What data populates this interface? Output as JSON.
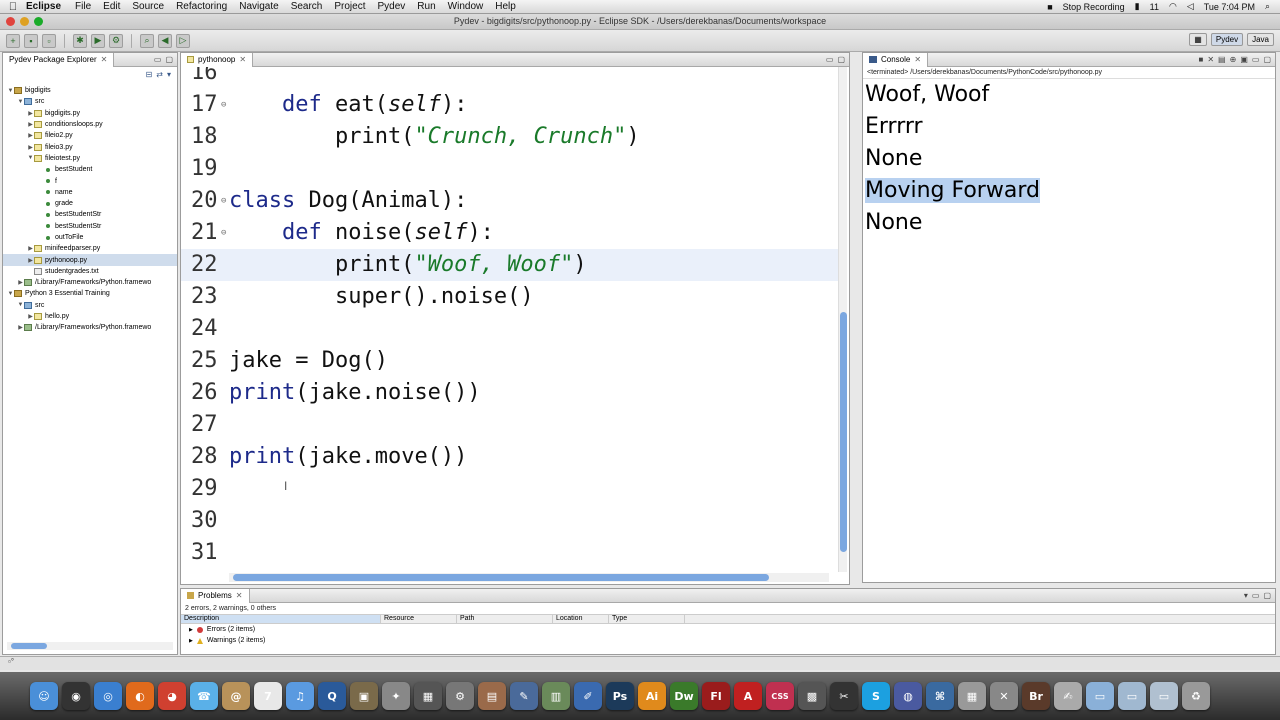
{
  "menubar": {
    "app": "Eclipse",
    "items": [
      "File",
      "Edit",
      "Source",
      "Refactoring",
      "Navigate",
      "Search",
      "Project",
      "Pydev",
      "Run",
      "Window",
      "Help"
    ],
    "stop_recording": "Stop Recording",
    "battery": "11",
    "clock": "Tue 7:04 PM"
  },
  "window": {
    "title": "Pydev - bigdigits/src/pythonoop.py - Eclipse SDK - /Users/derekbanas/Documents/workspace"
  },
  "perspectives": {
    "pydev": "Pydev",
    "java": "Java"
  },
  "explorer": {
    "tab_label": "Pydev Package Explorer",
    "tree": [
      {
        "label": "bigdigits",
        "icon": "project-icon",
        "indent": 0,
        "twisty": "▼"
      },
      {
        "label": "src",
        "icon": "package-icon",
        "indent": 1,
        "twisty": "▼"
      },
      {
        "label": "bigdigits.py",
        "icon": "python-file-icon",
        "indent": 2,
        "twisty": "▶"
      },
      {
        "label": "conditionsloops.py",
        "icon": "python-file-icon",
        "indent": 2,
        "twisty": "▶"
      },
      {
        "label": "fileio2.py",
        "icon": "python-file-icon",
        "indent": 2,
        "twisty": "▶"
      },
      {
        "label": "fileio3.py",
        "icon": "python-file-icon",
        "indent": 2,
        "twisty": "▶"
      },
      {
        "label": "fileiotest.py",
        "icon": "python-file-icon",
        "indent": 2,
        "twisty": "▼"
      },
      {
        "label": "bestStudent",
        "icon": "variable-icon",
        "indent": 3,
        "twisty": ""
      },
      {
        "label": "f",
        "icon": "variable-icon",
        "indent": 3,
        "twisty": ""
      },
      {
        "label": "name",
        "icon": "variable-icon",
        "indent": 3,
        "twisty": ""
      },
      {
        "label": "grade",
        "icon": "variable-icon",
        "indent": 3,
        "twisty": ""
      },
      {
        "label": "bestStudentStr",
        "icon": "variable-icon",
        "indent": 3,
        "twisty": ""
      },
      {
        "label": "bestStudentStr",
        "icon": "variable-icon",
        "indent": 3,
        "twisty": ""
      },
      {
        "label": "outToFile",
        "icon": "variable-icon",
        "indent": 3,
        "twisty": ""
      },
      {
        "label": "minifeedparser.py",
        "icon": "python-file-icon",
        "indent": 2,
        "twisty": "▶"
      },
      {
        "label": "pythonoop.py",
        "icon": "python-file-icon",
        "indent": 2,
        "twisty": "▶",
        "selected": true
      },
      {
        "label": "studentgrades.txt",
        "icon": "text-file-icon",
        "indent": 2,
        "twisty": ""
      },
      {
        "label": "/Library/Frameworks/Python.framewo",
        "icon": "library-icon",
        "indent": 1,
        "twisty": "▶"
      },
      {
        "label": "Python 3 Essential Training",
        "icon": "project-icon",
        "indent": 0,
        "twisty": "▼"
      },
      {
        "label": "src",
        "icon": "package-icon",
        "indent": 1,
        "twisty": "▼"
      },
      {
        "label": "hello.py",
        "icon": "python-file-icon",
        "indent": 2,
        "twisty": "▶"
      },
      {
        "label": "/Library/Frameworks/Python.framewo",
        "icon": "library-icon",
        "indent": 1,
        "twisty": "▶"
      }
    ]
  },
  "editor": {
    "tab_label": "pythonoop",
    "lines": [
      {
        "num": "16",
        "tokens": []
      },
      {
        "num": "17",
        "fold": true,
        "tokens": [
          [
            "",
            "    "
          ],
          [
            "kw",
            "def"
          ],
          [
            "",
            " eat("
          ],
          [
            "slf",
            "self"
          ],
          [
            "",
            "):"
          ]
        ]
      },
      {
        "num": "18",
        "tokens": [
          [
            "",
            "        print("
          ],
          [
            "str",
            "\"Crunch, Crunch\""
          ],
          [
            "",
            ")"
          ]
        ]
      },
      {
        "num": "19",
        "tokens": []
      },
      {
        "num": "20",
        "fold": true,
        "tokens": [
          [
            "kw",
            "class"
          ],
          [
            "",
            " Dog(Animal):"
          ]
        ]
      },
      {
        "num": "21",
        "fold": true,
        "tokens": [
          [
            "",
            "    "
          ],
          [
            "kw",
            "def"
          ],
          [
            "",
            " noise("
          ],
          [
            "slf",
            "self"
          ],
          [
            "",
            "):"
          ]
        ]
      },
      {
        "num": "22",
        "highlight": true,
        "tokens": [
          [
            "",
            "        print("
          ],
          [
            "str",
            "\"Woof, Woof\""
          ],
          [
            "",
            ")"
          ]
        ]
      },
      {
        "num": "23",
        "tokens": [
          [
            "",
            "        super().noise()"
          ]
        ]
      },
      {
        "num": "24",
        "tokens": []
      },
      {
        "num": "25",
        "tokens": [
          [
            "",
            "jake = Dog()"
          ]
        ]
      },
      {
        "num": "26",
        "tokens": [
          [
            "kw",
            "print"
          ],
          [
            "",
            "(jake.noise())"
          ]
        ]
      },
      {
        "num": "27",
        "tokens": []
      },
      {
        "num": "28",
        "tokens": [
          [
            "kw",
            "print"
          ],
          [
            "",
            "(jake.move())"
          ]
        ]
      },
      {
        "num": "29",
        "tokens": []
      },
      {
        "num": "30",
        "tokens": []
      },
      {
        "num": "31",
        "tokens": []
      }
    ]
  },
  "console": {
    "tab_label": "Console",
    "header": "<terminated> /Users/derekbanas/Documents/PythonCode/src/pythonoop.py",
    "output": [
      "Woof, Woof",
      "Errrrr",
      "None",
      "Moving Forward",
      "None"
    ],
    "selected_line_index": 3
  },
  "problems": {
    "tab_label": "Problems",
    "summary": "2 errors, 2 warnings, 0 others",
    "columns": [
      "Description",
      "Resource",
      "Path",
      "Location",
      "Type"
    ],
    "rows": [
      {
        "label": "Errors (2 items)",
        "kind": "error"
      },
      {
        "label": "Warnings (2 items)",
        "kind": "warning"
      }
    ]
  },
  "dock": {
    "apps": [
      {
        "name": "finder",
        "glyph": "☺",
        "color": "#4a8fd8"
      },
      {
        "name": "dashboard",
        "glyph": "◉",
        "color": "#333"
      },
      {
        "name": "safari",
        "glyph": "◎",
        "color": "#3a7fd0"
      },
      {
        "name": "firefox",
        "glyph": "◐",
        "color": "#e06a1c"
      },
      {
        "name": "chrome",
        "glyph": "◕",
        "color": "#d04030"
      },
      {
        "name": "ichat",
        "glyph": "☎",
        "color": "#5ab0e8"
      },
      {
        "name": "address-book",
        "glyph": "@",
        "color": "#b8925a"
      },
      {
        "name": "ical",
        "glyph": "7",
        "color": "#e8e8e8"
      },
      {
        "name": "itunes",
        "glyph": "♫",
        "color": "#5a9ae0"
      },
      {
        "name": "quicktime",
        "glyph": "Q",
        "color": "#2a5a9a"
      },
      {
        "name": "preview",
        "glyph": "▣",
        "color": "#7a6a4a"
      },
      {
        "name": "automator",
        "glyph": "✦",
        "color": "#888"
      },
      {
        "name": "mission-control",
        "glyph": "▦",
        "color": "#555"
      },
      {
        "name": "system-preferences",
        "glyph": "⚙",
        "color": "#777"
      },
      {
        "name": "photo",
        "glyph": "▤",
        "color": "#9a6a4a"
      },
      {
        "name": "xcode",
        "glyph": "✎",
        "color": "#4a6a9a"
      },
      {
        "name": "calculator",
        "glyph": "▥",
        "color": "#6a8a5a"
      },
      {
        "name": "text-edit",
        "glyph": "✐",
        "color": "#3a6ab0"
      },
      {
        "name": "photoshop",
        "glyph": "Ps",
        "color": "#1c3a5a"
      },
      {
        "name": "illustrator",
        "glyph": "Ai",
        "color": "#e08a1c"
      },
      {
        "name": "dreamweaver",
        "glyph": "Dw",
        "color": "#3a7a2a"
      },
      {
        "name": "flash",
        "glyph": "Fl",
        "color": "#9a1c1c"
      },
      {
        "name": "acrobat",
        "glyph": "A",
        "color": "#c02020"
      },
      {
        "name": "css-edit",
        "glyph": "CSS",
        "color": "#c03050"
      },
      {
        "name": "media-app",
        "glyph": "▩",
        "color": "#555"
      },
      {
        "name": "final-cut",
        "glyph": "✂",
        "color": "#333"
      },
      {
        "name": "skype",
        "glyph": "S",
        "color": "#1ca0e0"
      },
      {
        "name": "network",
        "glyph": "◍",
        "color": "#4a5aa0"
      },
      {
        "name": "python-launcher",
        "glyph": "⌘",
        "color": "#3a6aa0"
      },
      {
        "name": "terminal",
        "glyph": "▦",
        "color": "#999"
      },
      {
        "name": "utility",
        "glyph": "✕",
        "color": "#888"
      },
      {
        "name": "bridge",
        "glyph": "Br",
        "color": "#5a3a2a"
      },
      {
        "name": "script-editor",
        "glyph": "✍",
        "color": "#aaa"
      },
      {
        "name": "folder",
        "glyph": "▭",
        "color": "#8ab0d8"
      },
      {
        "name": "documents",
        "glyph": "▭",
        "color": "#a0b8d0"
      },
      {
        "name": "downloads",
        "glyph": "▭",
        "color": "#b0c0d0"
      },
      {
        "name": "trash",
        "glyph": "♻",
        "color": "#999"
      }
    ]
  }
}
